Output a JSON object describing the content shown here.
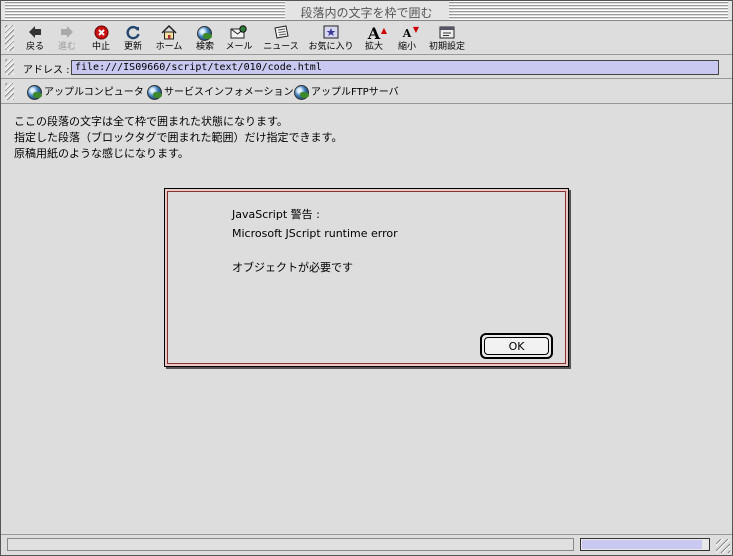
{
  "window": {
    "title": "段落内の文字を枠で囲む"
  },
  "toolbar": {
    "buttons": [
      {
        "label": "戻る",
        "icon": "back-arrow-icon",
        "enabled": true
      },
      {
        "label": "進む",
        "icon": "forward-arrow-icon",
        "enabled": false
      },
      {
        "label": "中止",
        "icon": "stop-icon",
        "enabled": true
      },
      {
        "label": "更新",
        "icon": "refresh-icon",
        "enabled": true
      },
      {
        "label": "ホーム",
        "icon": "home-icon",
        "enabled": true
      },
      {
        "label": "検索",
        "icon": "search-globe-icon",
        "enabled": true
      },
      {
        "label": "メール",
        "icon": "mail-icon",
        "enabled": true
      },
      {
        "label": "ニュース",
        "icon": "news-icon",
        "enabled": true
      },
      {
        "label": "お気に入り",
        "icon": "favorites-icon",
        "enabled": true
      },
      {
        "label": "拡大",
        "icon": "font-larger-icon",
        "enabled": true
      },
      {
        "label": "縮小",
        "icon": "font-smaller-icon",
        "enabled": true
      },
      {
        "label": "初期設定",
        "icon": "preferences-icon",
        "enabled": true
      }
    ]
  },
  "address": {
    "label": "アドレス :",
    "value": "file:///IS09660/script/text/010/code.html"
  },
  "favorites": [
    {
      "label": "アップルコンピュータ",
      "icon": "globe-icon"
    },
    {
      "label": "サービスインフォメーション",
      "icon": "globe-icon"
    },
    {
      "label": "アップルFTPサーバ",
      "icon": "globe-icon"
    }
  ],
  "content": {
    "lines": [
      "ここの段落の文字は全て枠で囲まれた状態になります。",
      "指定した段落（ブロックタグで囲まれた範囲）だけ指定できます。",
      "原稿用紙のような感じになります。"
    ]
  },
  "dialog": {
    "heading": "JavaScript 警告 :",
    "error": "Microsoft JScript runtime error",
    "message": "オブジェクトが必要です",
    "ok_label": "OK"
  },
  "status": {
    "progress": 0.95,
    "colors": {
      "progress_fill": "#c8c8f0",
      "dialog_border": "#8a2f2f",
      "stop_red": "#cc1111"
    }
  }
}
